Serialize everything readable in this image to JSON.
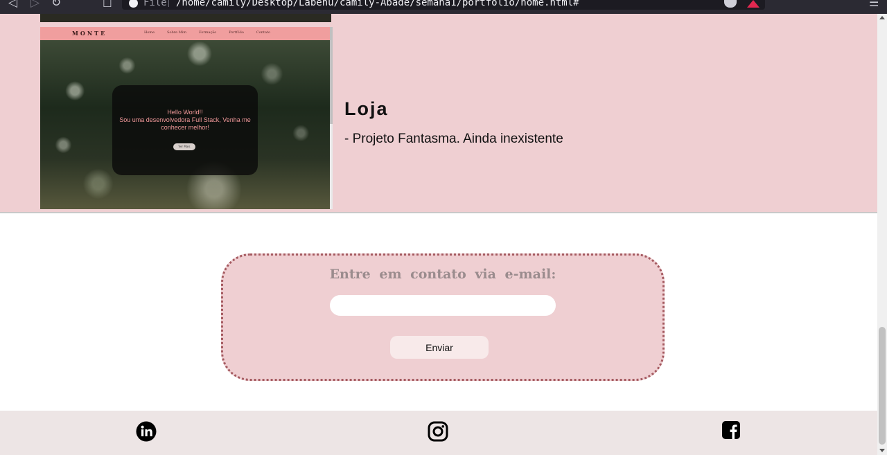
{
  "browser": {
    "scheme_label": "File",
    "url": "/home/camily/Desktop/Labenu/camily-Abade/semana1/portfolio/home.html#",
    "back_icon": "back-arrow-icon",
    "forward_icon": "forward-arrow-icon",
    "reload_icon": "reload-icon",
    "bookmark_icon": "bookmark-icon",
    "menu_icon": "hamburger-menu-icon"
  },
  "project": {
    "title": "Loja",
    "description": "- Projeto Fantasma. Ainda inexistente",
    "preview": {
      "logo": "MONTE",
      "nav_links": [
        "Home",
        "Sobre Mim",
        "Formação",
        "Portfólio",
        "Contato"
      ],
      "hello_line1": "Hello World!!",
      "hello_line2": "Sou uma desenvolvedora Full Stack, Venha me",
      "hello_line3": "conhecer melhor!",
      "button": "Ver Mais"
    }
  },
  "contact": {
    "heading": "Entre em contato via e-mail:",
    "email_value": "",
    "send_label": "Enviar"
  },
  "footer": {
    "social": [
      {
        "name": "linkedin",
        "icon": "linkedin-icon"
      },
      {
        "name": "instagram",
        "icon": "instagram-icon"
      },
      {
        "name": "facebook",
        "icon": "facebook-icon"
      }
    ]
  },
  "colors": {
    "section_pink": "#efcfd2",
    "border_dotted": "#a55a60",
    "footer_bg": "#ede5e5",
    "heading_gray": "#9b8c8e"
  }
}
